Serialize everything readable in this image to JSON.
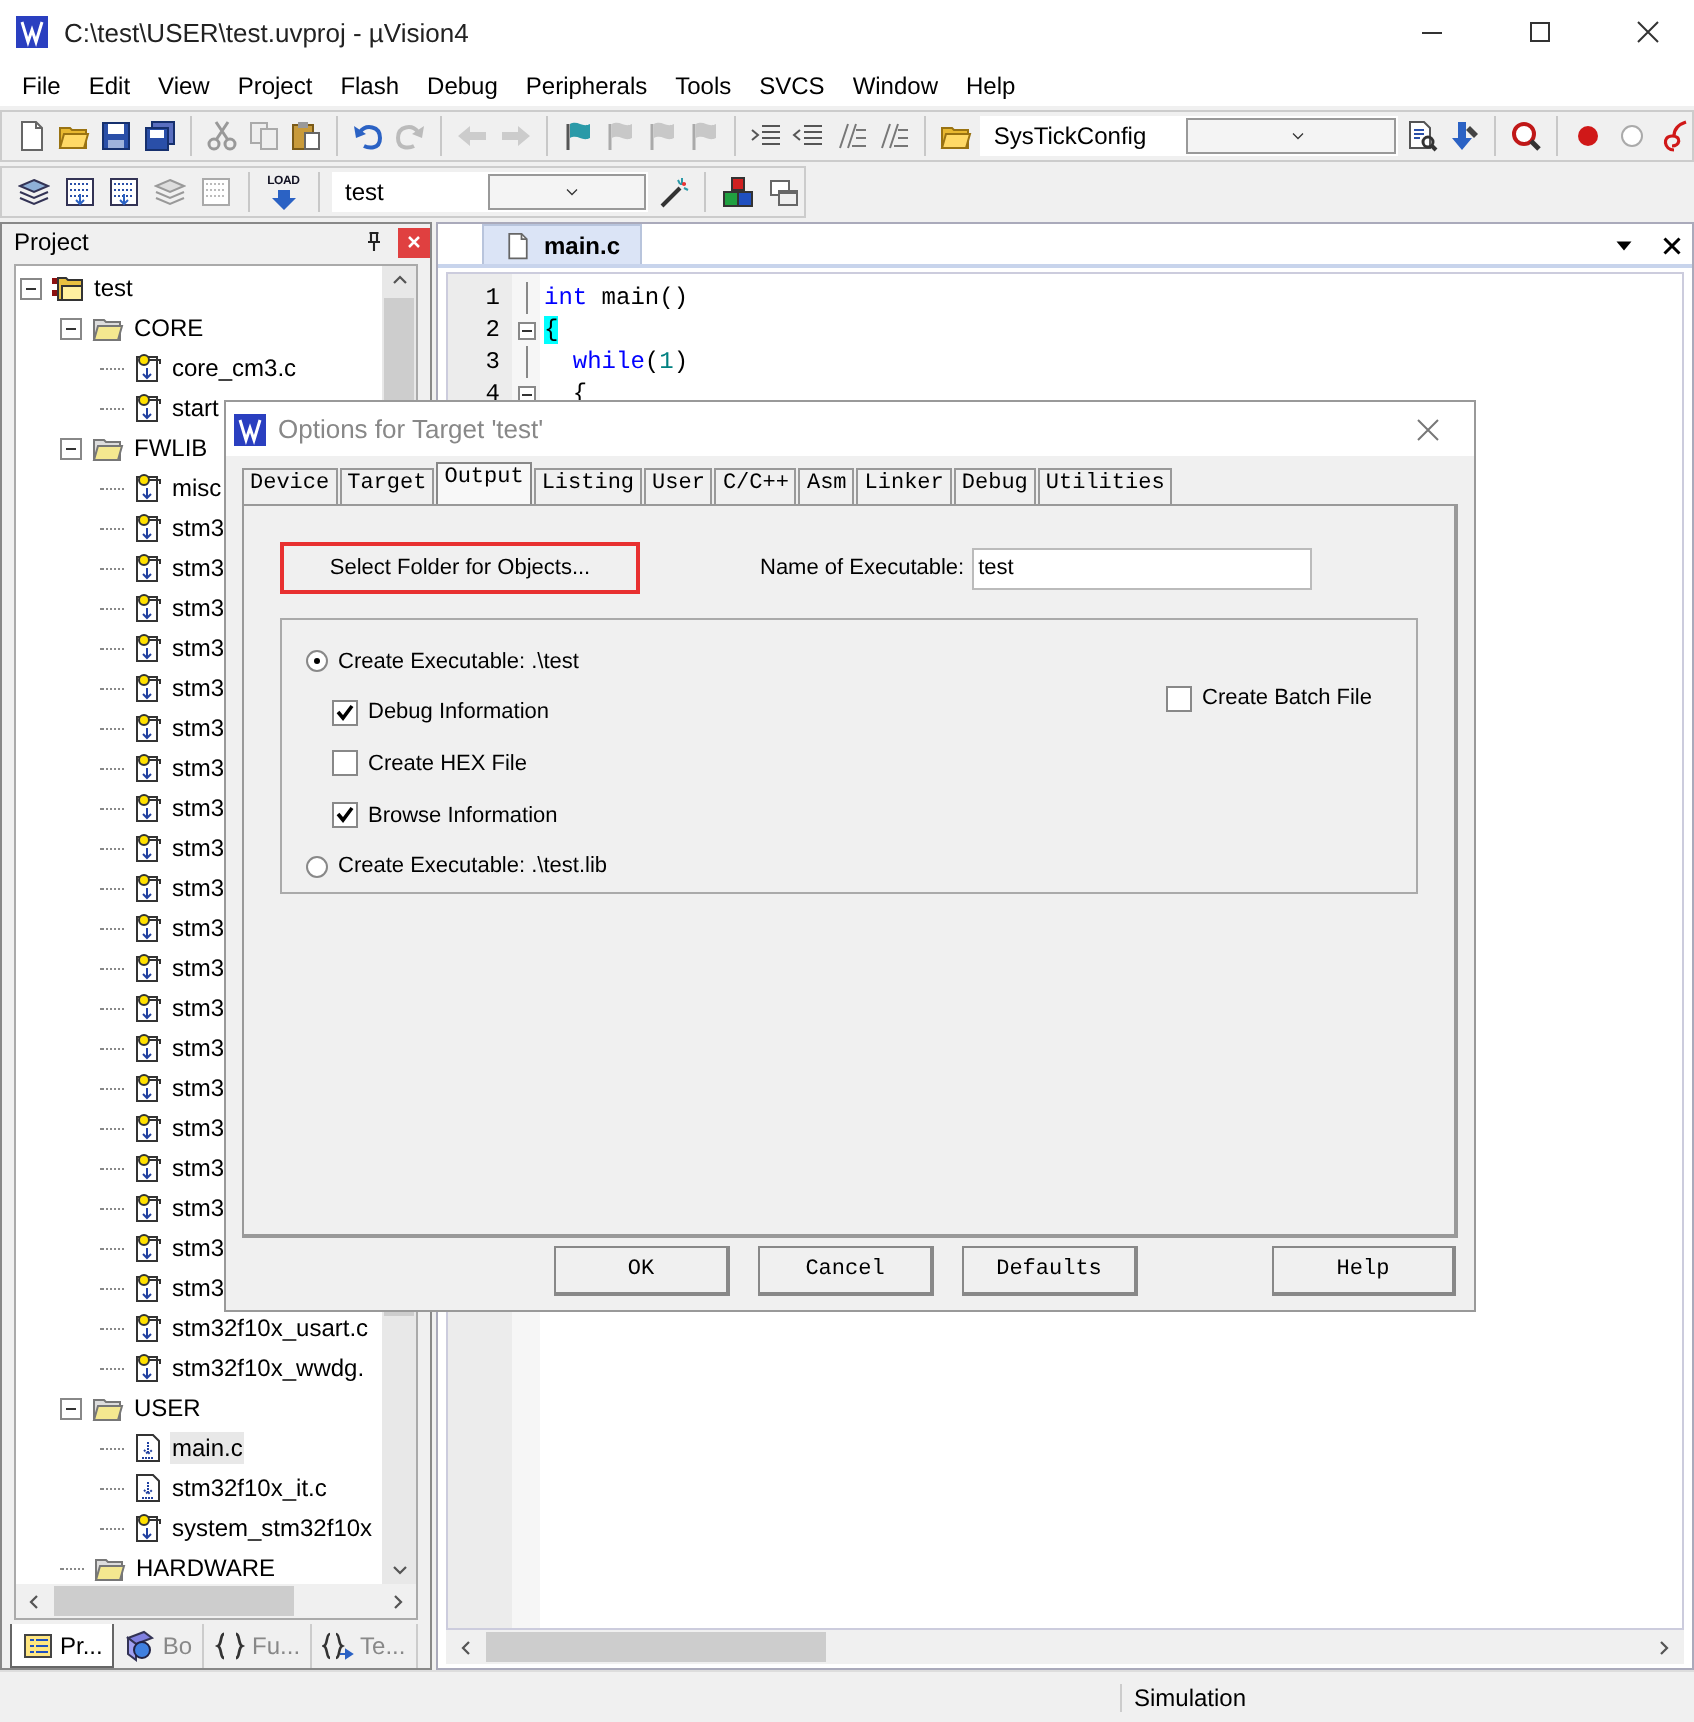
{
  "window": {
    "title": "C:\\test\\USER\\test.uvproj - µVision4"
  },
  "menu": [
    "File",
    "Edit",
    "View",
    "Project",
    "Flash",
    "Debug",
    "Peripherals",
    "Tools",
    "SVCS",
    "Window",
    "Help"
  ],
  "toolbar": {
    "function_combo": "SysTickConfig",
    "load_button": "LOAD",
    "target_combo": "test"
  },
  "project_panel": {
    "title": "Project",
    "tree": [
      {
        "label": "test",
        "kind": "project",
        "expanded": true,
        "selected": false,
        "children": [
          {
            "label": "CORE",
            "kind": "group",
            "expanded": true,
            "selected": false,
            "children": [
              {
                "label": "core_cm3.c",
                "kind": "file",
                "read_only": true,
                "selected": false
              },
              {
                "label": "start",
                "kind": "file",
                "read_only": true,
                "selected": false
              }
            ]
          },
          {
            "label": "FWLIB",
            "kind": "group",
            "expanded": true,
            "selected": false,
            "children": [
              {
                "label": "misc",
                "kind": "file",
                "read_only": true,
                "selected": false
              },
              {
                "label": "stm3",
                "kind": "file",
                "read_only": true,
                "selected": false
              },
              {
                "label": "stm3",
                "kind": "file",
                "read_only": true,
                "selected": false
              },
              {
                "label": "stm3",
                "kind": "file",
                "read_only": true,
                "selected": false
              },
              {
                "label": "stm3",
                "kind": "file",
                "read_only": true,
                "selected": false
              },
              {
                "label": "stm3",
                "kind": "file",
                "read_only": true,
                "selected": false
              },
              {
                "label": "stm3",
                "kind": "file",
                "read_only": true,
                "selected": false
              },
              {
                "label": "stm3",
                "kind": "file",
                "read_only": true,
                "selected": false
              },
              {
                "label": "stm3",
                "kind": "file",
                "read_only": true,
                "selected": false
              },
              {
                "label": "stm3",
                "kind": "file",
                "read_only": true,
                "selected": false
              },
              {
                "label": "stm3",
                "kind": "file",
                "read_only": true,
                "selected": false
              },
              {
                "label": "stm3",
                "kind": "file",
                "read_only": true,
                "selected": false
              },
              {
                "label": "stm3",
                "kind": "file",
                "read_only": true,
                "selected": false
              },
              {
                "label": "stm3",
                "kind": "file",
                "read_only": true,
                "selected": false
              },
              {
                "label": "stm3",
                "kind": "file",
                "read_only": true,
                "selected": false
              },
              {
                "label": "stm3",
                "kind": "file",
                "read_only": true,
                "selected": false
              },
              {
                "label": "stm3",
                "kind": "file",
                "read_only": true,
                "selected": false
              },
              {
                "label": "stm3",
                "kind": "file",
                "read_only": true,
                "selected": false
              },
              {
                "label": "stm3",
                "kind": "file",
                "read_only": true,
                "selected": false
              },
              {
                "label": "stm3",
                "kind": "file",
                "read_only": true,
                "selected": false
              },
              {
                "label": "stm3",
                "kind": "file",
                "read_only": true,
                "selected": false
              },
              {
                "label": "stm32f10x_usart.c",
                "kind": "file",
                "read_only": true,
                "selected": false
              },
              {
                "label": "stm32f10x_wwdg.",
                "kind": "file",
                "read_only": true,
                "selected": false
              }
            ]
          },
          {
            "label": "USER",
            "kind": "group",
            "expanded": true,
            "selected": false,
            "children": [
              {
                "label": "main.c",
                "kind": "file",
                "read_only": false,
                "selected": true
              },
              {
                "label": "stm32f10x_it.c",
                "kind": "file",
                "read_only": false,
                "selected": false
              },
              {
                "label": "system_stm32f10x",
                "kind": "file",
                "read_only": true,
                "selected": false
              }
            ]
          },
          {
            "label": "HARDWARE",
            "kind": "group",
            "selected": false
          }
        ]
      }
    ],
    "tabs": [
      {
        "label": "Pr...",
        "kind": "project",
        "selected": true
      },
      {
        "label": "Bo",
        "kind": "books",
        "selected": false
      },
      {
        "label": "Fu...",
        "kind": "functions",
        "selected": false
      },
      {
        "label": "Te...",
        "kind": "templates",
        "selected": false
      }
    ]
  },
  "editor": {
    "tabs": [
      {
        "label": "main.c",
        "selected": true
      }
    ],
    "lines": [
      {
        "number": "1",
        "foldable": false,
        "tokens": [
          {
            "text": "int",
            "kind": "keyword"
          },
          {
            "text": " main()",
            "kind": "plain"
          }
        ]
      },
      {
        "number": "2",
        "foldable": true,
        "tokens": [
          {
            "text": "{",
            "kind": "brace_match"
          }
        ]
      },
      {
        "number": "3",
        "foldable": false,
        "tokens": [
          {
            "text": "  while",
            "kind": "keyword"
          },
          {
            "text": "(",
            "kind": "plain"
          },
          {
            "text": "1",
            "kind": "number"
          },
          {
            "text": ")",
            "kind": "plain"
          }
        ]
      },
      {
        "number": "4",
        "foldable": true,
        "tokens": [
          {
            "text": "  {",
            "kind": "plain"
          }
        ]
      }
    ]
  },
  "dialog": {
    "title": "Options for Target 'test'",
    "tabs": [
      {
        "label": "Device",
        "selected": false
      },
      {
        "label": "Target",
        "selected": false
      },
      {
        "label": "Output",
        "selected": true
      },
      {
        "label": "Listing",
        "selected": false
      },
      {
        "label": "User",
        "selected": false
      },
      {
        "label": "C/C++",
        "selected": false
      },
      {
        "label": "Asm",
        "selected": false
      },
      {
        "label": "Linker",
        "selected": false
      },
      {
        "label": "Debug",
        "selected": false
      },
      {
        "label": "Utilities",
        "selected": false
      }
    ],
    "select_folder_button": {
      "label": "Select Folder for Objects...",
      "highlighted": true
    },
    "name_of_executable": {
      "label": "Name of Executable:",
      "value": "test"
    },
    "output_options": [
      {
        "kind": "radio",
        "label": "Create Executable:  .\\test",
        "selected": true
      },
      {
        "kind": "checkbox",
        "label": "Debug Information",
        "checked": true
      },
      {
        "kind": "checkbox",
        "label": "Create HEX File",
        "checked": false
      },
      {
        "kind": "checkbox",
        "label": "Browse Information",
        "checked": true
      },
      {
        "kind": "radio",
        "label": "Create Executable:  .\\test.lib",
        "selected": false
      }
    ],
    "create_batch_file": {
      "label": "Create Batch File",
      "checked": false
    },
    "buttons": [
      "OK",
      "Cancel",
      "Defaults",
      "Help"
    ]
  },
  "status_bar": {
    "mode": "Simulation"
  }
}
